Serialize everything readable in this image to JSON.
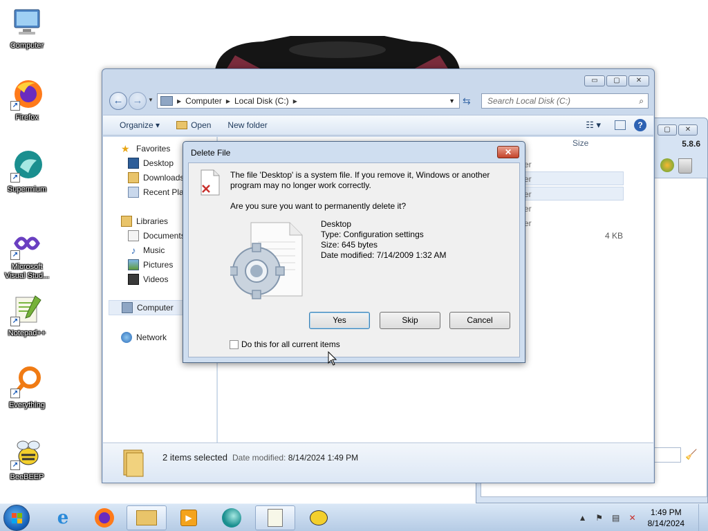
{
  "desktop_icons": [
    {
      "label": "Computer",
      "icon": "computer-icon"
    },
    {
      "label": "Firefox",
      "icon": "firefox-icon"
    },
    {
      "label": "Supermium",
      "icon": "supermium-icon"
    },
    {
      "label": "Microsoft Visual Stud...",
      "icon": "visual-studio-icon"
    },
    {
      "label": "Notepad++",
      "icon": "notepadpp-icon"
    },
    {
      "label": "Everything",
      "icon": "everything-icon"
    },
    {
      "label": "BeeBEEP",
      "icon": "beebeep-icon"
    }
  ],
  "secondary_window": {
    "version": "5.8.6"
  },
  "explorer": {
    "controls": {
      "minimize": "▭",
      "maximize": "▢",
      "close": "✕"
    },
    "address": {
      "seg1": "Computer",
      "seg2": "Local Disk (C:)"
    },
    "search_placeholder": "Search Local Disk (C:)",
    "toolbar": {
      "organize": "Organize ▾",
      "open": "Open",
      "new_folder": "New folder"
    },
    "nav": {
      "favorites": "Favorites",
      "desktop": "Desktop",
      "downloads": "Downloads",
      "recent": "Recent Plac",
      "libraries": "Libraries",
      "documents": "Documents",
      "music": "Music",
      "pictures": "Pictures",
      "videos": "Videos",
      "computer": "Computer",
      "network": "Network"
    },
    "column_size": "Size",
    "size_value": "4 KB",
    "partial_rows": [
      "er",
      "er",
      "er",
      "er",
      "er"
    ],
    "details": {
      "selection": "2 items selected",
      "date_label": "Date modified:",
      "date_value": "8/14/2024 1:49 PM"
    }
  },
  "dialog": {
    "title": "Delete File",
    "close": "✕",
    "message": "The file 'Desktop' is a system file. If you remove it, Windows or another program may no longer work correctly.",
    "question": "Are you sure you want to permanently delete it?",
    "file": {
      "name": "Desktop",
      "type": "Type: Configuration settings",
      "size": "Size: 645 bytes",
      "modified": "Date modified: 7/14/2009 1:32 AM"
    },
    "buttons": {
      "yes": "Yes",
      "skip": "Skip",
      "cancel": "Cancel"
    },
    "checkbox_label": "Do this for all current items",
    "checkbox_checked": false
  },
  "taskbar": {
    "clock_time": "1:49 PM",
    "clock_date": "8/14/2024",
    "active_item": "windows-explorer"
  },
  "colors": {
    "window_frame": "#cad9ec",
    "dialog_body": "#f0f0f0",
    "close_button": "#c4432a",
    "taskbar": "#b5cbe5"
  }
}
